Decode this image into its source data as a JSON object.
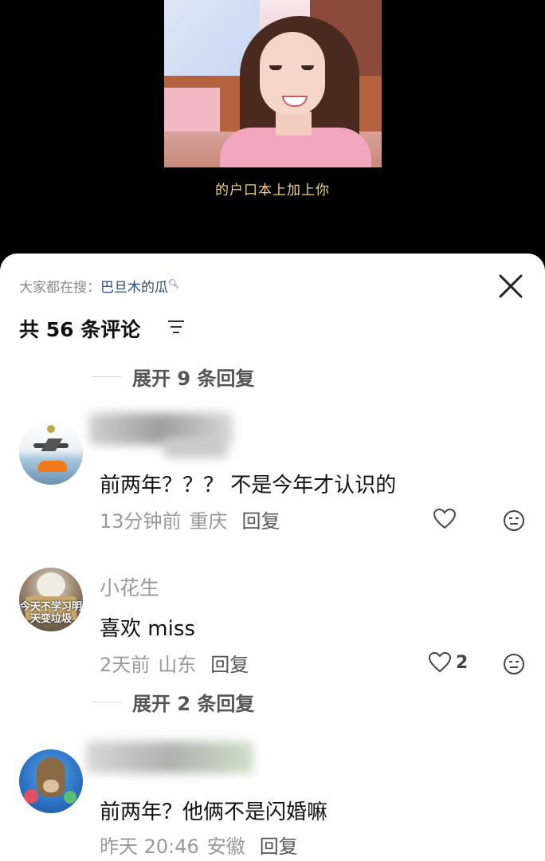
{
  "video": {
    "subtitle": "的户口本上加上你"
  },
  "sheet": {
    "search_prefix": "大家都在搜：",
    "search_keyword": "巴旦木的瓜",
    "comment_count_title": "共 56 条评论"
  },
  "expand_1": "展开 9 条回复",
  "expand_2": "展开 2 条回复",
  "comments": [
    {
      "username": "",
      "text": "前两年？？？ 不是今年才认识的",
      "time": "13分钟前",
      "location": "重庆",
      "reply": "回复",
      "likes": ""
    },
    {
      "username": "小花生",
      "avatar_text": "今天不学习明天变垃圾",
      "text": "喜欢 miss",
      "time": "2天前",
      "location": "山东",
      "reply": "回复",
      "likes": "2"
    },
    {
      "username": "",
      "text": "前两年？他俩不是闪婚嘛",
      "time": "昨天 20:46",
      "location": "安徽",
      "reply": "回复",
      "likes": ""
    }
  ],
  "colors": {
    "subtitle": "#f3d27a",
    "keyword": "#2b4d7a",
    "text": "#111111",
    "meta": "#9a9a9a"
  },
  "icons": [
    "close-icon",
    "sort-icon",
    "heart-icon",
    "emoji-icon",
    "search-icon"
  ]
}
